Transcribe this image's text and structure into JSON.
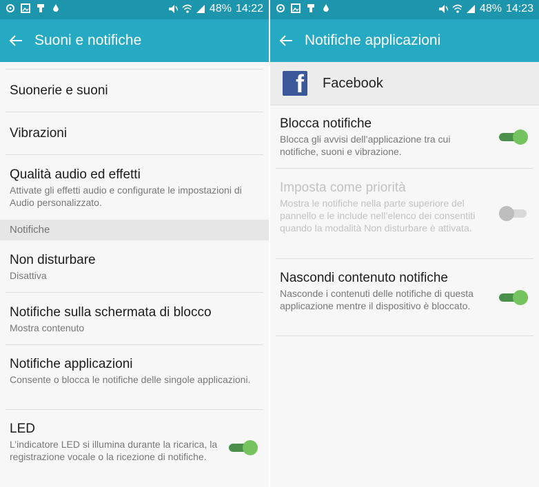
{
  "screens": {
    "left": {
      "status": {
        "battery": "48%",
        "time": "14:22"
      },
      "title": "Suoni e notifiche",
      "items": [
        {
          "title": "Suonerie e suoni"
        },
        {
          "title": "Vibrazioni"
        },
        {
          "title": "Qualità audio ed effetti",
          "subtitle": "Attivate gli effetti audio e configurate le impostazioni di Audio personalizzato."
        }
      ],
      "section": "Notifiche",
      "items2": [
        {
          "title": "Non disturbare",
          "subtitle": "Disattiva"
        },
        {
          "title": "Notifiche sulla schermata di blocco",
          "subtitle": "Mostra contenuto"
        },
        {
          "title": "Notifiche applicazioni",
          "subtitle": "Consente o blocca le notifiche delle singole applicazioni."
        },
        {
          "title": "LED",
          "subtitle": "L’indicatore LED si illumina durante la ricarica, la registrazione vocale o la ricezione di notifiche.",
          "toggle": true
        }
      ]
    },
    "right": {
      "status": {
        "battery": "48%",
        "time": "14:23"
      },
      "title": "Notifiche applicazioni",
      "app": "Facebook",
      "items": [
        {
          "title": "Blocca notifiche",
          "subtitle": "Blocca gli avvisi dell’applicazione tra cui notifiche, suoni e vibrazione.",
          "toggle": true
        },
        {
          "title": "Imposta come priorità",
          "subtitle": "Mostra le notifiche nella parte superiore del pannello e le include nell’elenco dei consentiti quando la modalità Non disturbare è attivata.",
          "toggle": false
        },
        {
          "title": "Nascondi contenuto notifiche",
          "subtitle": "Nasconde i contenuti delle notifiche di questa applicazione mentre il dispositivo è bloccato.",
          "toggle": true
        }
      ]
    }
  },
  "icons": [
    "settings-icon",
    "image-icon",
    "usb-icon",
    "drop-icon",
    "mute-icon",
    "wifi-icon",
    "signal-icon",
    "back-arrow-icon",
    "facebook-logo-icon"
  ],
  "colors": {
    "statusbar": "#1d96ad",
    "appbar": "#26a9c3",
    "toggle_on": "#74c35f"
  }
}
